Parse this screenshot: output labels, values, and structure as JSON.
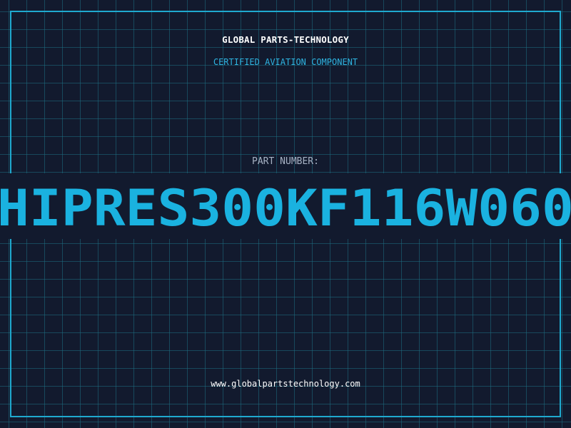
{
  "header": {
    "company": "GLOBAL PARTS-TECHNOLOGY",
    "subtitle": "CERTIFIED AVIATION COMPONENT"
  },
  "part": {
    "label": "PART NUMBER:",
    "number": "HIPRES300KF116W060"
  },
  "footer": {
    "url": "www.globalpartstechnology.com"
  },
  "colors": {
    "background": "#121a2e",
    "accent": "#1ab2e0",
    "grid": "#1e6e82",
    "frame": "#1fa9cf"
  }
}
